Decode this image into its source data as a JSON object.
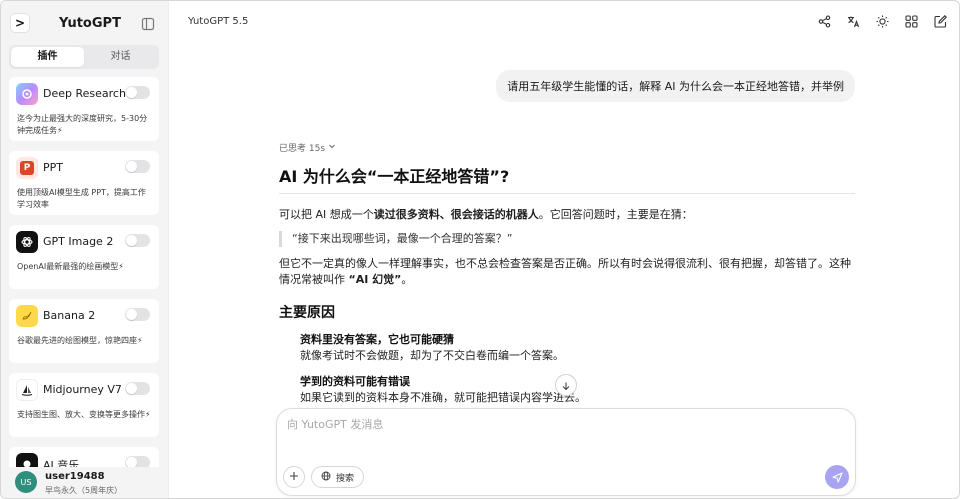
{
  "sidebar": {
    "app_name": "YutoGPT",
    "logo_glyph": ">",
    "tabs": [
      {
        "label": "插件",
        "active": true
      },
      {
        "label": "对话",
        "active": false
      }
    ],
    "plugins": [
      {
        "name": "Deep Research",
        "desc": "迄今为止最强大的深度研究，5-30分钟完成任务⚡",
        "icon": "deep-research-icon",
        "enabled": false
      },
      {
        "name": "PPT",
        "desc": "使用顶级AI模型生成 PPT，提高工作学习效率",
        "icon": "ppt-icon",
        "icon_text": "P",
        "enabled": false
      },
      {
        "name": "GPT Image 2",
        "desc": "OpenAI最新最强的绘画模型⚡",
        "icon": "openai-icon",
        "enabled": false
      },
      {
        "name": "Banana 2",
        "desc": "谷歌最先进的绘图模型，惊艳四座⚡",
        "icon": "banana-icon",
        "enabled": false
      },
      {
        "name": "Midjourney V7",
        "desc": "支持图生图、放大、变换等更多操作⚡",
        "icon": "midjourney-icon",
        "enabled": false
      },
      {
        "name": "AI 音乐",
        "desc": "",
        "icon": "music-icon",
        "enabled": false
      }
    ],
    "user": {
      "avatar_text": "US",
      "name": "user19488",
      "plan": "早鸟永久（5周年庆）"
    }
  },
  "header": {
    "model_name": "YutoGPT 5.5",
    "icons": [
      "share-icon",
      "translate-icon",
      "theme-icon",
      "grid-icon",
      "new-chat-icon"
    ]
  },
  "conversation": {
    "user_message": "请用五年级学生能懂的话，解释 AI 为什么会一本正经地答错，并举例",
    "assistant": {
      "thought_label": "已思考 15s",
      "title": "AI 为什么会“一本正经地答错”?",
      "p1_pre": "可以把 AI 想成一个",
      "p1_bold": "读过很多资料、很会接话的机器人",
      "p1_post": "。它回答问题时，主要是在猜：",
      "quote": "“接下来出现哪些词，最像一个合理的答案？”",
      "p2_pre": "但它不一定真的像人一样理解事实，也不总会检查答案是否正确。所以有时会说得很流利、很有把握，却答错了。这种情况常被叫作 ",
      "p2_bold": "“AI 幻觉”",
      "p2_post": "。",
      "section_title": "主要原因",
      "reasons": [
        {
          "title": "资料里没有答案，它也可能硬猜",
          "desc": "就像考试时不会做题，却为了不交白卷而编一个答案。"
        },
        {
          "title": "学到的资料可能有错误",
          "desc": "如果它读到的资料本身不准确，就可能把错误内容学进去。"
        }
      ]
    }
  },
  "composer": {
    "placeholder": "向 YutoGPT 发消息",
    "search_label": "搜索"
  },
  "colors": {
    "accent": "#a9a4f2",
    "avatar": "#2f8f7d",
    "sidebar_bg": "#f4f4f5"
  }
}
